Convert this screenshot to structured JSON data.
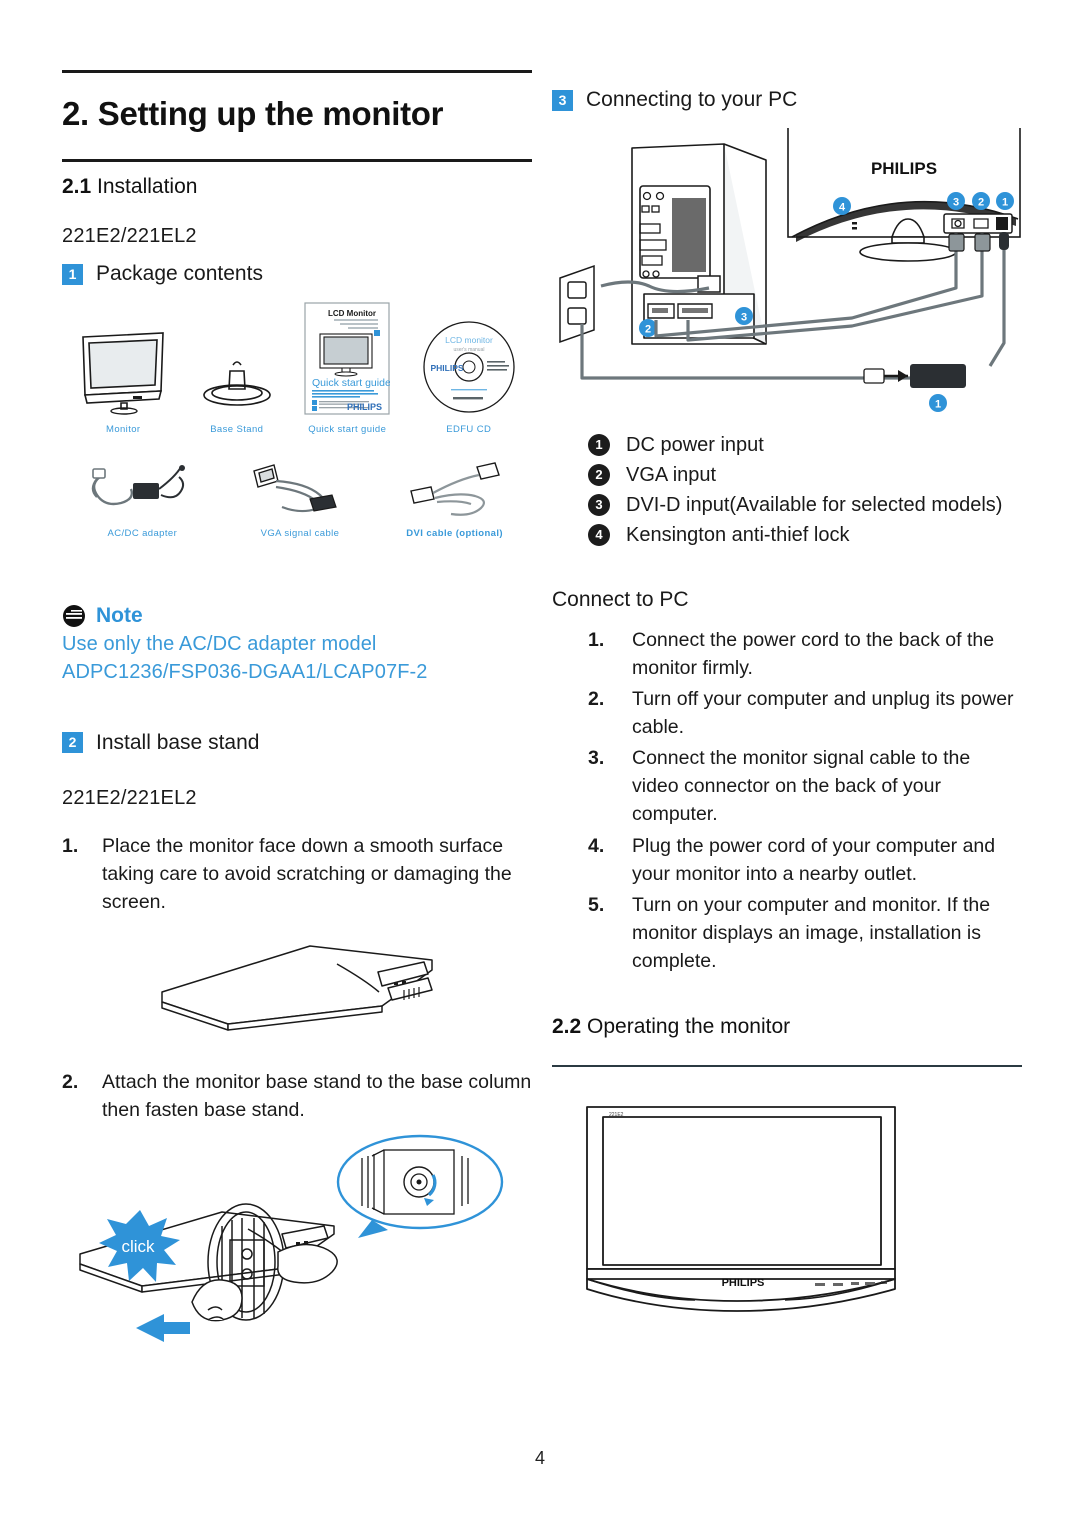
{
  "document": {
    "chapter_title": "2. Setting up the monitor",
    "page_number": "4"
  },
  "left": {
    "section_number": "2.1",
    "section_title": "Installation",
    "model": "221E2/221EL2",
    "package": {
      "badge": "1",
      "label": "Package contents",
      "items": [
        {
          "caption": "Monitor",
          "icon": "monitor-icon",
          "bold": false
        },
        {
          "caption": "Base Stand",
          "icon": "base-stand-icon",
          "bold": false
        },
        {
          "caption": "Quick start guide",
          "icon": "quick-start-guide-icon",
          "bold": false
        },
        {
          "caption": "EDFU CD",
          "icon": "cd-disc-icon",
          "bold": false
        },
        {
          "caption": "AC/DC adapter",
          "icon": "ac-dc-adapter-icon",
          "bold": false
        },
        {
          "caption": "VGA signal cable",
          "icon": "vga-cable-icon",
          "bold": false
        },
        {
          "caption": "DVI cable (optional)",
          "icon": "dvi-cable-icon",
          "bold": true
        }
      ],
      "guide_thumb": {
        "heading": "LCD  Monitor",
        "title": "Quick start guide",
        "brand": "PHILIPS"
      },
      "cd_thumb": {
        "title": "LCD monitor",
        "subtitle": "user's manual",
        "brand": "PHILIPS"
      }
    },
    "note": {
      "title": "Note",
      "icon": "note-icon",
      "body": "Use only the AC/DC adapter model  ADPC1236/FSP036-DGAA1/LCAP07F-2"
    },
    "install": {
      "badge": "2",
      "label": "Install base stand",
      "model": "221E2/221EL2",
      "steps": [
        {
          "n": "1.",
          "text": "Place the monitor face down a smooth surface taking care to avoid scratching or damaging the screen."
        },
        {
          "n": "2.",
          "text": "Attach the monitor base stand to the base column then fasten base stand."
        }
      ],
      "click_label": "click"
    }
  },
  "right": {
    "connect": {
      "badge": "3",
      "label": "Connecting to your PC",
      "monitor_brand": "PHILIPS",
      "diagram_callouts": [
        "1",
        "2",
        "3",
        "4"
      ],
      "ports": [
        {
          "n": "1",
          "label": "DC power input"
        },
        {
          "n": "2",
          "label": "VGA input"
        },
        {
          "n": "3",
          "label": "DVI-D input(Available for selected models)"
        },
        {
          "n": "4",
          "label": "Kensington anti-thief lock"
        }
      ],
      "connect_title": "Connect to PC",
      "steps": [
        {
          "n": "1.",
          "text": "Connect the power cord to the back of the monitor firmly."
        },
        {
          "n": "2.",
          "text": "Turn off your computer and unplug its power cable."
        },
        {
          "n": "3.",
          "text": "Connect the monitor signal cable to the video connector on the back of your computer."
        },
        {
          "n": "4.",
          "text": "Plug the power cord of your computer and your monitor into a nearby outlet."
        },
        {
          "n": "5.",
          "text": "Turn on your computer and monitor. If the monitor displays an image, installation is complete."
        }
      ]
    },
    "operating": {
      "section_number": "2.2",
      "section_title": "Operating the monitor",
      "monitor_brand": "PHILIPS"
    }
  },
  "colors": {
    "accent_blue": "#2f93d8",
    "caption_blue": "#3a9ad9",
    "ink": "#1a1a1a"
  }
}
